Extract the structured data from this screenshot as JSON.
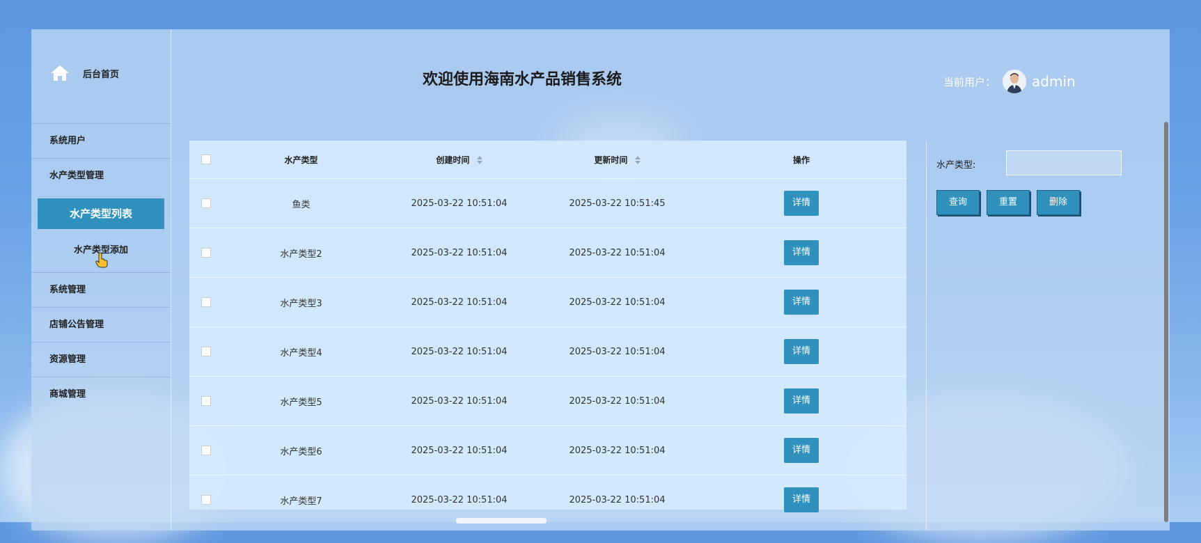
{
  "header": {
    "title": "欢迎使用海南水产品销售系统",
    "user_label": "当前用户：",
    "user_name": "admin"
  },
  "sidebar": {
    "home_label": "后台首页",
    "items": [
      {
        "label": "系统用户"
      },
      {
        "label": "水产类型管理"
      },
      {
        "label": "系统管理"
      },
      {
        "label": "店铺公告管理"
      },
      {
        "label": "资源管理"
      },
      {
        "label": "商城管理"
      }
    ],
    "submenu": {
      "active_label": "水产类型列表",
      "add_label": "水产类型添加"
    }
  },
  "table": {
    "columns": [
      "水产类型",
      "创建时间",
      "更新时间",
      "操作"
    ],
    "detail_label": "详情",
    "rows": [
      {
        "type": "鱼类",
        "created": "2025-03-22 10:51:04",
        "updated": "2025-03-22 10:51:45"
      },
      {
        "type": "水产类型2",
        "created": "2025-03-22 10:51:04",
        "updated": "2025-03-22 10:51:04"
      },
      {
        "type": "水产类型3",
        "created": "2025-03-22 10:51:04",
        "updated": "2025-03-22 10:51:04"
      },
      {
        "type": "水产类型4",
        "created": "2025-03-22 10:51:04",
        "updated": "2025-03-22 10:51:04"
      },
      {
        "type": "水产类型5",
        "created": "2025-03-22 10:51:04",
        "updated": "2025-03-22 10:51:04"
      },
      {
        "type": "水产类型6",
        "created": "2025-03-22 10:51:04",
        "updated": "2025-03-22 10:51:04"
      },
      {
        "type": "水产类型7",
        "created": "2025-03-22 10:51:04",
        "updated": "2025-03-22 10:51:04"
      }
    ]
  },
  "search": {
    "label": "水产类型:",
    "value": "",
    "query_label": "查询",
    "reset_label": "重置",
    "delete_label": "删除"
  },
  "colors": {
    "accent": "#3090be",
    "background": "#6aa2e6"
  },
  "icons": {
    "home": "home-icon",
    "avatar": "user-avatar",
    "sort": "sort-icon",
    "cursor": "hand-pointer-icon"
  }
}
